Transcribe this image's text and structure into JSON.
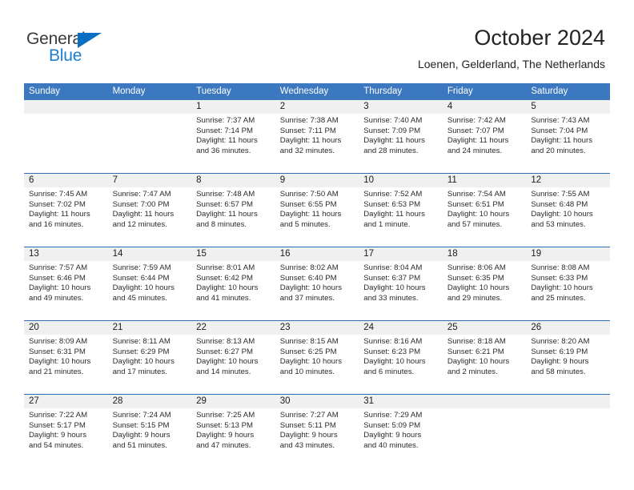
{
  "brand": {
    "name_part1": "General",
    "name_part2": "Blue",
    "triangle_color": "#0a6fc2",
    "blue_color": "#1a7fd4"
  },
  "header": {
    "title": "October 2024",
    "subtitle": "Loenen, Gelderland, The Netherlands"
  },
  "theme": {
    "header_blue": "#3b78bf",
    "row_divider_blue": "#2e6cb3",
    "daynum_band": "#f0f0f0"
  },
  "weekdays": [
    "Sunday",
    "Monday",
    "Tuesday",
    "Wednesday",
    "Thursday",
    "Friday",
    "Saturday"
  ],
  "weeks": [
    [
      {
        "day": "",
        "sunrise": "",
        "sunset": "",
        "daylight1": "",
        "daylight2": ""
      },
      {
        "day": "",
        "sunrise": "",
        "sunset": "",
        "daylight1": "",
        "daylight2": ""
      },
      {
        "day": "1",
        "sunrise": "Sunrise: 7:37 AM",
        "sunset": "Sunset: 7:14 PM",
        "daylight1": "Daylight: 11 hours",
        "daylight2": "and 36 minutes."
      },
      {
        "day": "2",
        "sunrise": "Sunrise: 7:38 AM",
        "sunset": "Sunset: 7:11 PM",
        "daylight1": "Daylight: 11 hours",
        "daylight2": "and 32 minutes."
      },
      {
        "day": "3",
        "sunrise": "Sunrise: 7:40 AM",
        "sunset": "Sunset: 7:09 PM",
        "daylight1": "Daylight: 11 hours",
        "daylight2": "and 28 minutes."
      },
      {
        "day": "4",
        "sunrise": "Sunrise: 7:42 AM",
        "sunset": "Sunset: 7:07 PM",
        "daylight1": "Daylight: 11 hours",
        "daylight2": "and 24 minutes."
      },
      {
        "day": "5",
        "sunrise": "Sunrise: 7:43 AM",
        "sunset": "Sunset: 7:04 PM",
        "daylight1": "Daylight: 11 hours",
        "daylight2": "and 20 minutes."
      }
    ],
    [
      {
        "day": "6",
        "sunrise": "Sunrise: 7:45 AM",
        "sunset": "Sunset: 7:02 PM",
        "daylight1": "Daylight: 11 hours",
        "daylight2": "and 16 minutes."
      },
      {
        "day": "7",
        "sunrise": "Sunrise: 7:47 AM",
        "sunset": "Sunset: 7:00 PM",
        "daylight1": "Daylight: 11 hours",
        "daylight2": "and 12 minutes."
      },
      {
        "day": "8",
        "sunrise": "Sunrise: 7:48 AM",
        "sunset": "Sunset: 6:57 PM",
        "daylight1": "Daylight: 11 hours",
        "daylight2": "and 8 minutes."
      },
      {
        "day": "9",
        "sunrise": "Sunrise: 7:50 AM",
        "sunset": "Sunset: 6:55 PM",
        "daylight1": "Daylight: 11 hours",
        "daylight2": "and 5 minutes."
      },
      {
        "day": "10",
        "sunrise": "Sunrise: 7:52 AM",
        "sunset": "Sunset: 6:53 PM",
        "daylight1": "Daylight: 11 hours",
        "daylight2": "and 1 minute."
      },
      {
        "day": "11",
        "sunrise": "Sunrise: 7:54 AM",
        "sunset": "Sunset: 6:51 PM",
        "daylight1": "Daylight: 10 hours",
        "daylight2": "and 57 minutes."
      },
      {
        "day": "12",
        "sunrise": "Sunrise: 7:55 AM",
        "sunset": "Sunset: 6:48 PM",
        "daylight1": "Daylight: 10 hours",
        "daylight2": "and 53 minutes."
      }
    ],
    [
      {
        "day": "13",
        "sunrise": "Sunrise: 7:57 AM",
        "sunset": "Sunset: 6:46 PM",
        "daylight1": "Daylight: 10 hours",
        "daylight2": "and 49 minutes."
      },
      {
        "day": "14",
        "sunrise": "Sunrise: 7:59 AM",
        "sunset": "Sunset: 6:44 PM",
        "daylight1": "Daylight: 10 hours",
        "daylight2": "and 45 minutes."
      },
      {
        "day": "15",
        "sunrise": "Sunrise: 8:01 AM",
        "sunset": "Sunset: 6:42 PM",
        "daylight1": "Daylight: 10 hours",
        "daylight2": "and 41 minutes."
      },
      {
        "day": "16",
        "sunrise": "Sunrise: 8:02 AM",
        "sunset": "Sunset: 6:40 PM",
        "daylight1": "Daylight: 10 hours",
        "daylight2": "and 37 minutes."
      },
      {
        "day": "17",
        "sunrise": "Sunrise: 8:04 AM",
        "sunset": "Sunset: 6:37 PM",
        "daylight1": "Daylight: 10 hours",
        "daylight2": "and 33 minutes."
      },
      {
        "day": "18",
        "sunrise": "Sunrise: 8:06 AM",
        "sunset": "Sunset: 6:35 PM",
        "daylight1": "Daylight: 10 hours",
        "daylight2": "and 29 minutes."
      },
      {
        "day": "19",
        "sunrise": "Sunrise: 8:08 AM",
        "sunset": "Sunset: 6:33 PM",
        "daylight1": "Daylight: 10 hours",
        "daylight2": "and 25 minutes."
      }
    ],
    [
      {
        "day": "20",
        "sunrise": "Sunrise: 8:09 AM",
        "sunset": "Sunset: 6:31 PM",
        "daylight1": "Daylight: 10 hours",
        "daylight2": "and 21 minutes."
      },
      {
        "day": "21",
        "sunrise": "Sunrise: 8:11 AM",
        "sunset": "Sunset: 6:29 PM",
        "daylight1": "Daylight: 10 hours",
        "daylight2": "and 17 minutes."
      },
      {
        "day": "22",
        "sunrise": "Sunrise: 8:13 AM",
        "sunset": "Sunset: 6:27 PM",
        "daylight1": "Daylight: 10 hours",
        "daylight2": "and 14 minutes."
      },
      {
        "day": "23",
        "sunrise": "Sunrise: 8:15 AM",
        "sunset": "Sunset: 6:25 PM",
        "daylight1": "Daylight: 10 hours",
        "daylight2": "and 10 minutes."
      },
      {
        "day": "24",
        "sunrise": "Sunrise: 8:16 AM",
        "sunset": "Sunset: 6:23 PM",
        "daylight1": "Daylight: 10 hours",
        "daylight2": "and 6 minutes."
      },
      {
        "day": "25",
        "sunrise": "Sunrise: 8:18 AM",
        "sunset": "Sunset: 6:21 PM",
        "daylight1": "Daylight: 10 hours",
        "daylight2": "and 2 minutes."
      },
      {
        "day": "26",
        "sunrise": "Sunrise: 8:20 AM",
        "sunset": "Sunset: 6:19 PM",
        "daylight1": "Daylight: 9 hours",
        "daylight2": "and 58 minutes."
      }
    ],
    [
      {
        "day": "27",
        "sunrise": "Sunrise: 7:22 AM",
        "sunset": "Sunset: 5:17 PM",
        "daylight1": "Daylight: 9 hours",
        "daylight2": "and 54 minutes."
      },
      {
        "day": "28",
        "sunrise": "Sunrise: 7:24 AM",
        "sunset": "Sunset: 5:15 PM",
        "daylight1": "Daylight: 9 hours",
        "daylight2": "and 51 minutes."
      },
      {
        "day": "29",
        "sunrise": "Sunrise: 7:25 AM",
        "sunset": "Sunset: 5:13 PM",
        "daylight1": "Daylight: 9 hours",
        "daylight2": "and 47 minutes."
      },
      {
        "day": "30",
        "sunrise": "Sunrise: 7:27 AM",
        "sunset": "Sunset: 5:11 PM",
        "daylight1": "Daylight: 9 hours",
        "daylight2": "and 43 minutes."
      },
      {
        "day": "31",
        "sunrise": "Sunrise: 7:29 AM",
        "sunset": "Sunset: 5:09 PM",
        "daylight1": "Daylight: 9 hours",
        "daylight2": "and 40 minutes."
      },
      {
        "day": "",
        "sunrise": "",
        "sunset": "",
        "daylight1": "",
        "daylight2": ""
      },
      {
        "day": "",
        "sunrise": "",
        "sunset": "",
        "daylight1": "",
        "daylight2": ""
      }
    ]
  ]
}
